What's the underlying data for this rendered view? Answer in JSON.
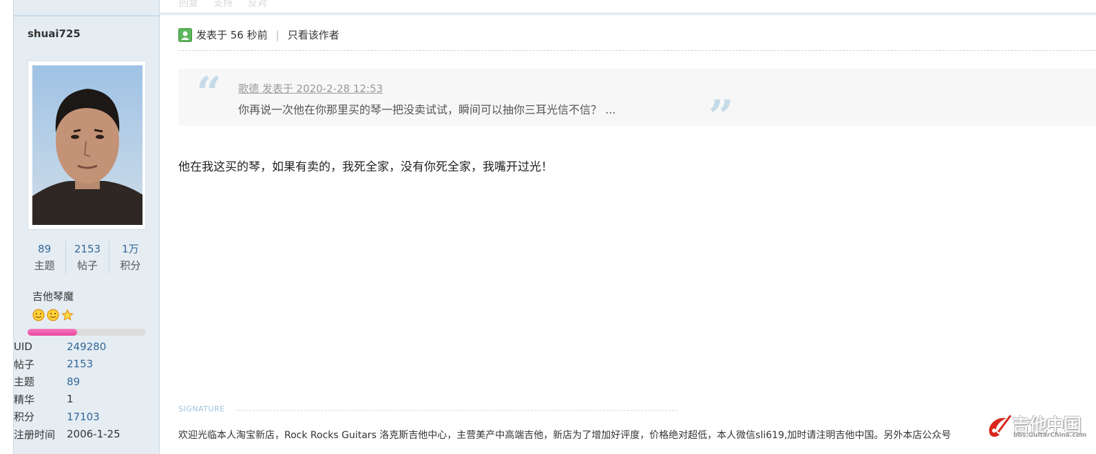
{
  "top_actions": [
    "回复",
    "支持",
    "反对"
  ],
  "author": {
    "username": "shuai725",
    "stats": [
      {
        "value": "89",
        "label": "主题"
      },
      {
        "value": "2153",
        "label": "帖子"
      },
      {
        "value": "1万",
        "label": "积分"
      }
    ],
    "rank_title": "吉他琴魔",
    "rank_progress": 0.42,
    "profile": [
      {
        "key": "UID",
        "value": "249280"
      },
      {
        "key": "帖子",
        "value": "2153"
      },
      {
        "key": "主题",
        "value": "89"
      },
      {
        "key": "精华",
        "value": "1"
      },
      {
        "key": "积分",
        "value": "17103"
      },
      {
        "key": "注册时间",
        "value": "2006-1-25"
      }
    ]
  },
  "post": {
    "posted_at": "发表于 56 秒前",
    "separator": "|",
    "only_author_link": "只看该作者",
    "quote": {
      "author_line": "歌德 发表于 2020-2-28 12:53",
      "text": "你再说一次他在你那里买的琴一把没卖试试，瞬间可以抽你三耳光信不信？ ..."
    },
    "body": "他在我这买的琴，如果有卖的，我死全家，没有你死全家，我嘴开过光！"
  },
  "signature": {
    "label": "SIGNATURE",
    "text": "欢迎光临本人淘宝新店，Rock Rocks Guitars 洛克斯吉他中心，主营美产中高端吉他，新店为了增加好评度，价格绝对超低，本人微信sli619,加时请注明吉他中国。另外本店公众号"
  },
  "watermark": {
    "title": "吉他中国",
    "subtitle": "bbs.GuitarChina.com"
  },
  "colors": {
    "sidebar_bg": "#e5edf2",
    "link_blue": "#336699",
    "progress_pink": "#e9479c"
  }
}
